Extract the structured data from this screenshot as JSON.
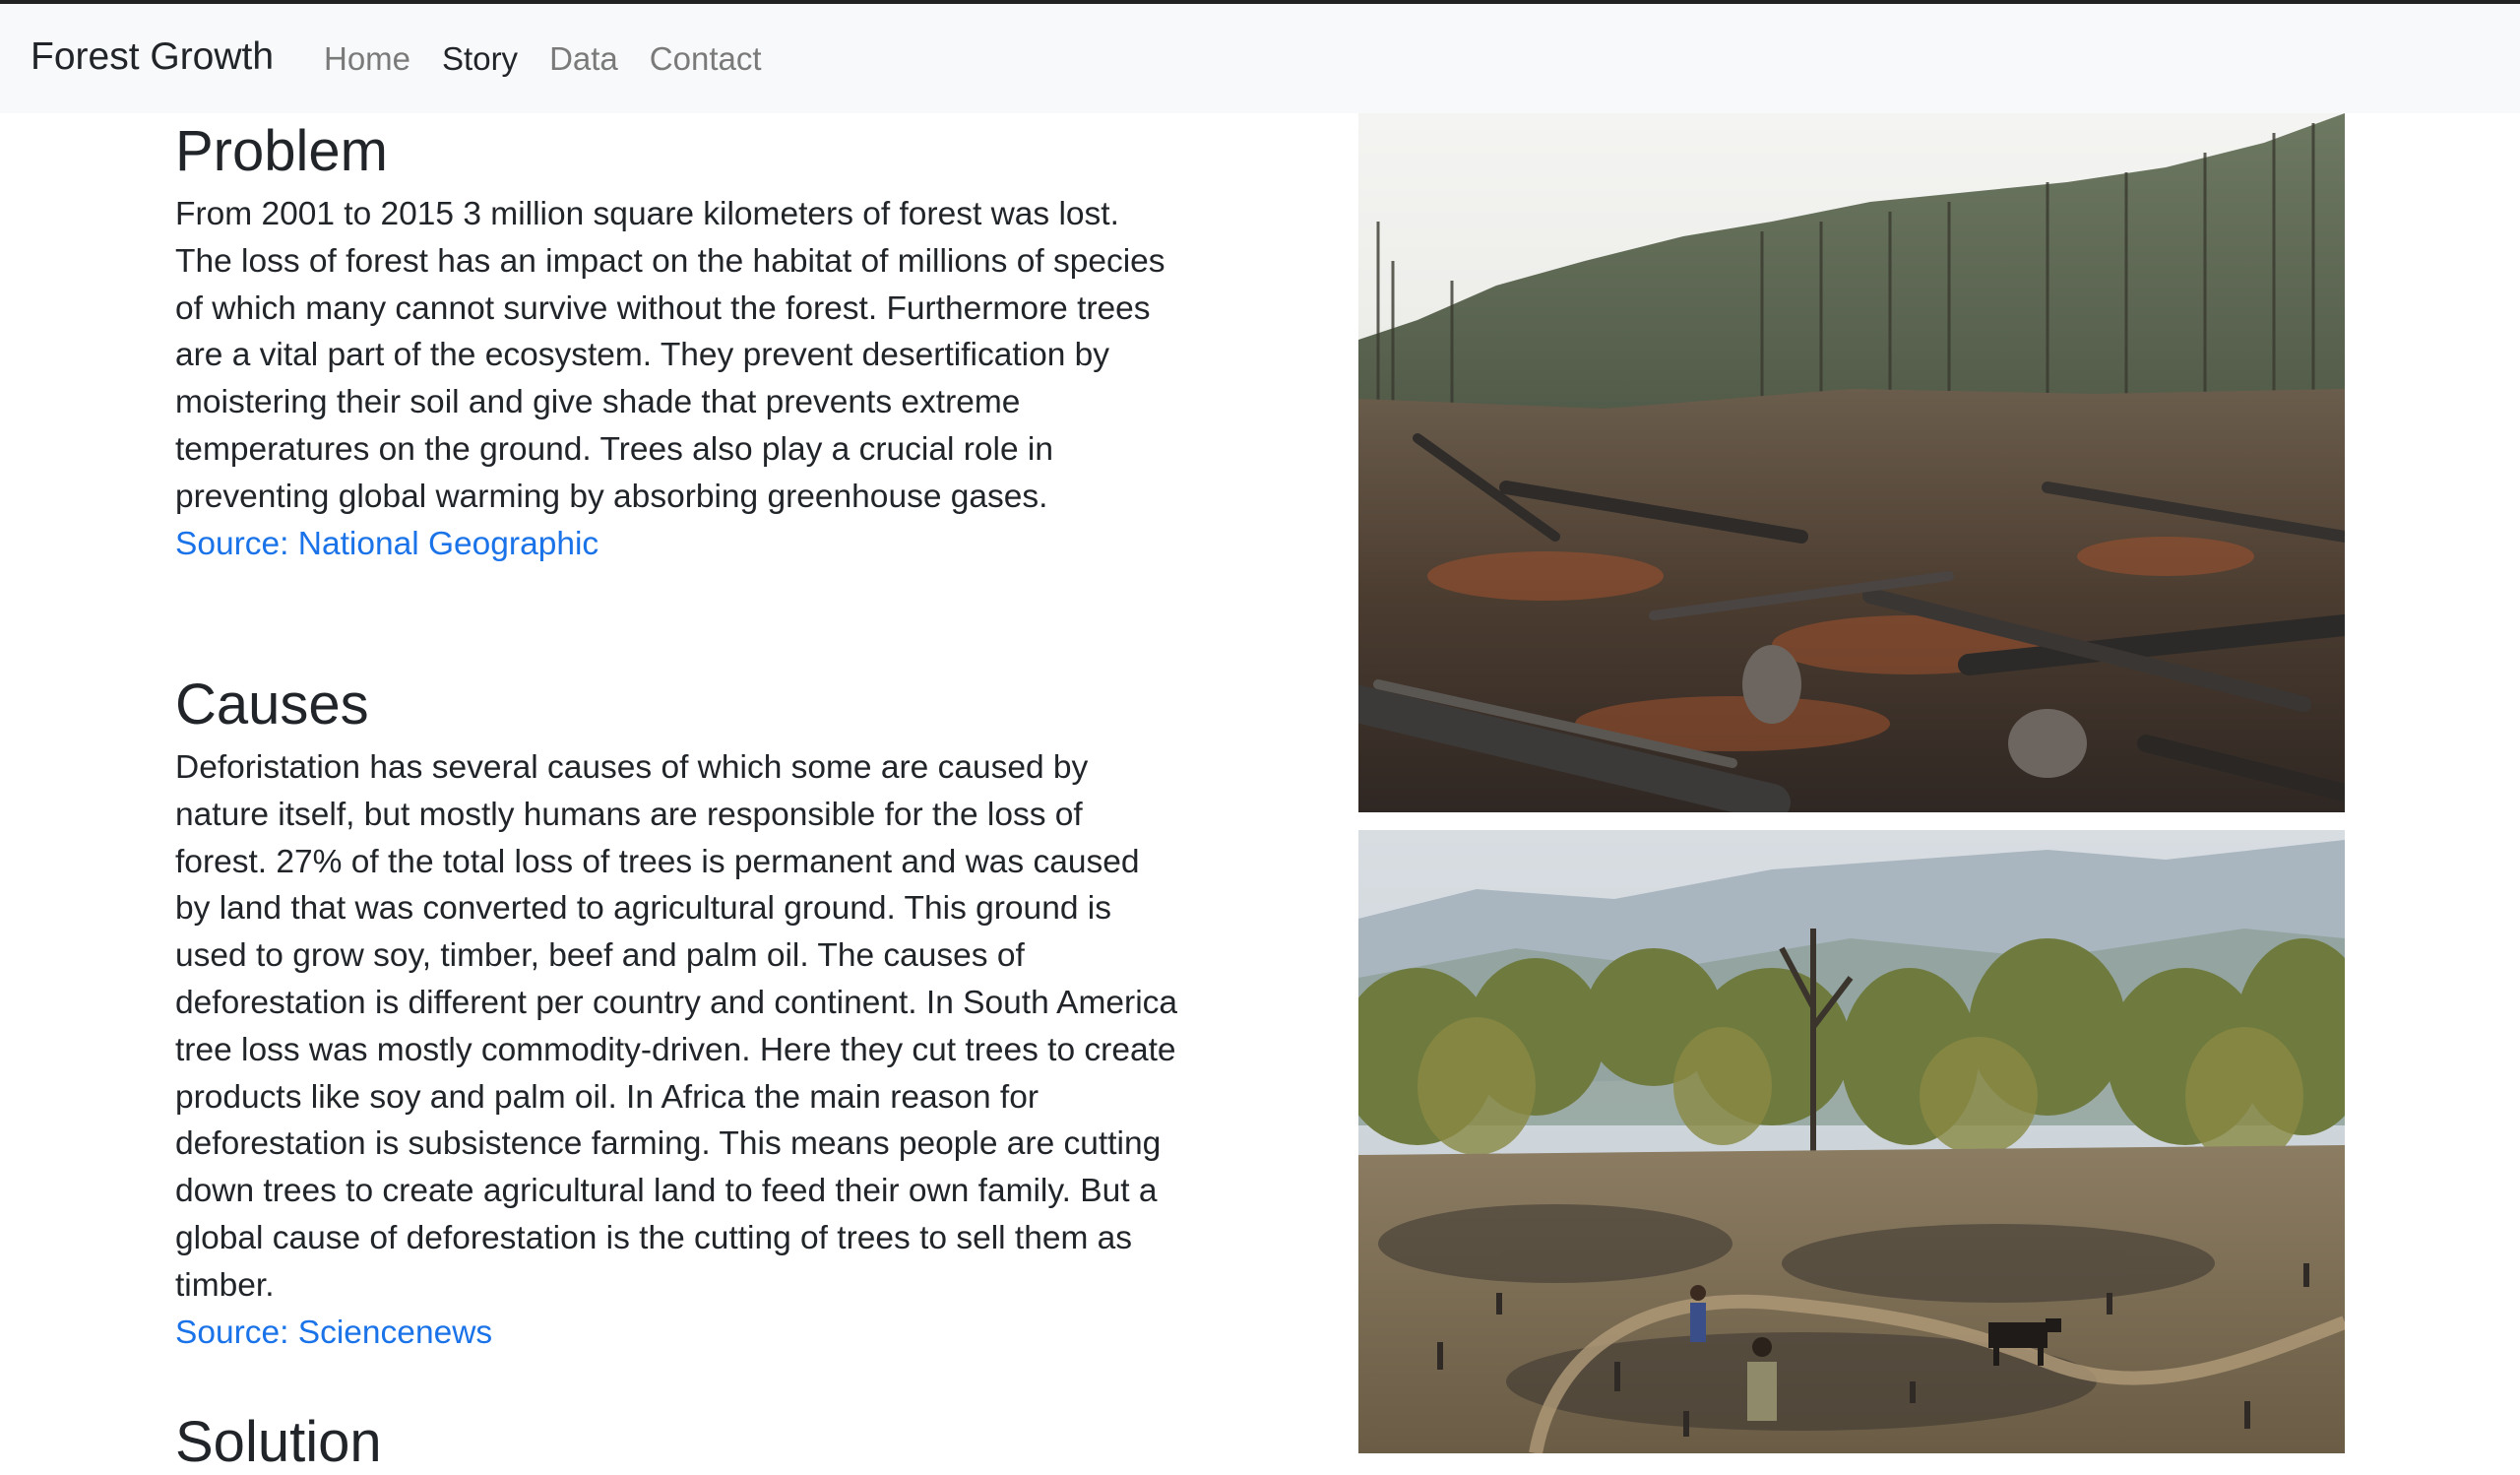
{
  "navbar": {
    "brand": "Forest Growth",
    "links": [
      {
        "label": "Home",
        "active": false
      },
      {
        "label": "Story",
        "active": true
      },
      {
        "label": "Data",
        "active": false
      },
      {
        "label": "Contact",
        "active": false
      }
    ]
  },
  "sections": {
    "problem": {
      "title": "Problem",
      "text": "From 2001 to 2015 3 million square kilometers of forest was lost. The loss of forest has an impact on the habitat of millions of species of which many cannot survive without the forest. Furthermore trees are a vital part of the ecosystem. They prevent desertification by moistering their soil and give shade that prevents extreme temperatures on the ground. Trees also play a crucial role in preventing global warming by absorbing greenhouse gases.",
      "source": "Source: National Geographic"
    },
    "causes": {
      "title": "Causes",
      "text": "Deforistation has several causes of which some are caused by nature itself, but mostly humans are responsible for the loss of forest. 27% of the total loss of trees is permanent and was caused by land that was converted to agricultural ground. This ground is used to grow soy, timber, beef and palm oil. The causes of deforestation is different per country and continent. In South America tree loss was mostly commodity-driven. Here they cut trees to create products like soy and palm oil. In Africa the main reason for deforestation is subsistence farming. This means people are cutting down trees to create agricultural land to feed their own family. But a global cause of deforestation is the cutting of trees to sell them as timber.",
      "source": "Source: Sciencenews"
    },
    "solution": {
      "title": "Solution"
    }
  },
  "colors": {
    "link": "#1a73e8",
    "navbar_bg": "#f8f9fa",
    "text": "#212529",
    "nav_inactive": "#7a7a7a"
  }
}
